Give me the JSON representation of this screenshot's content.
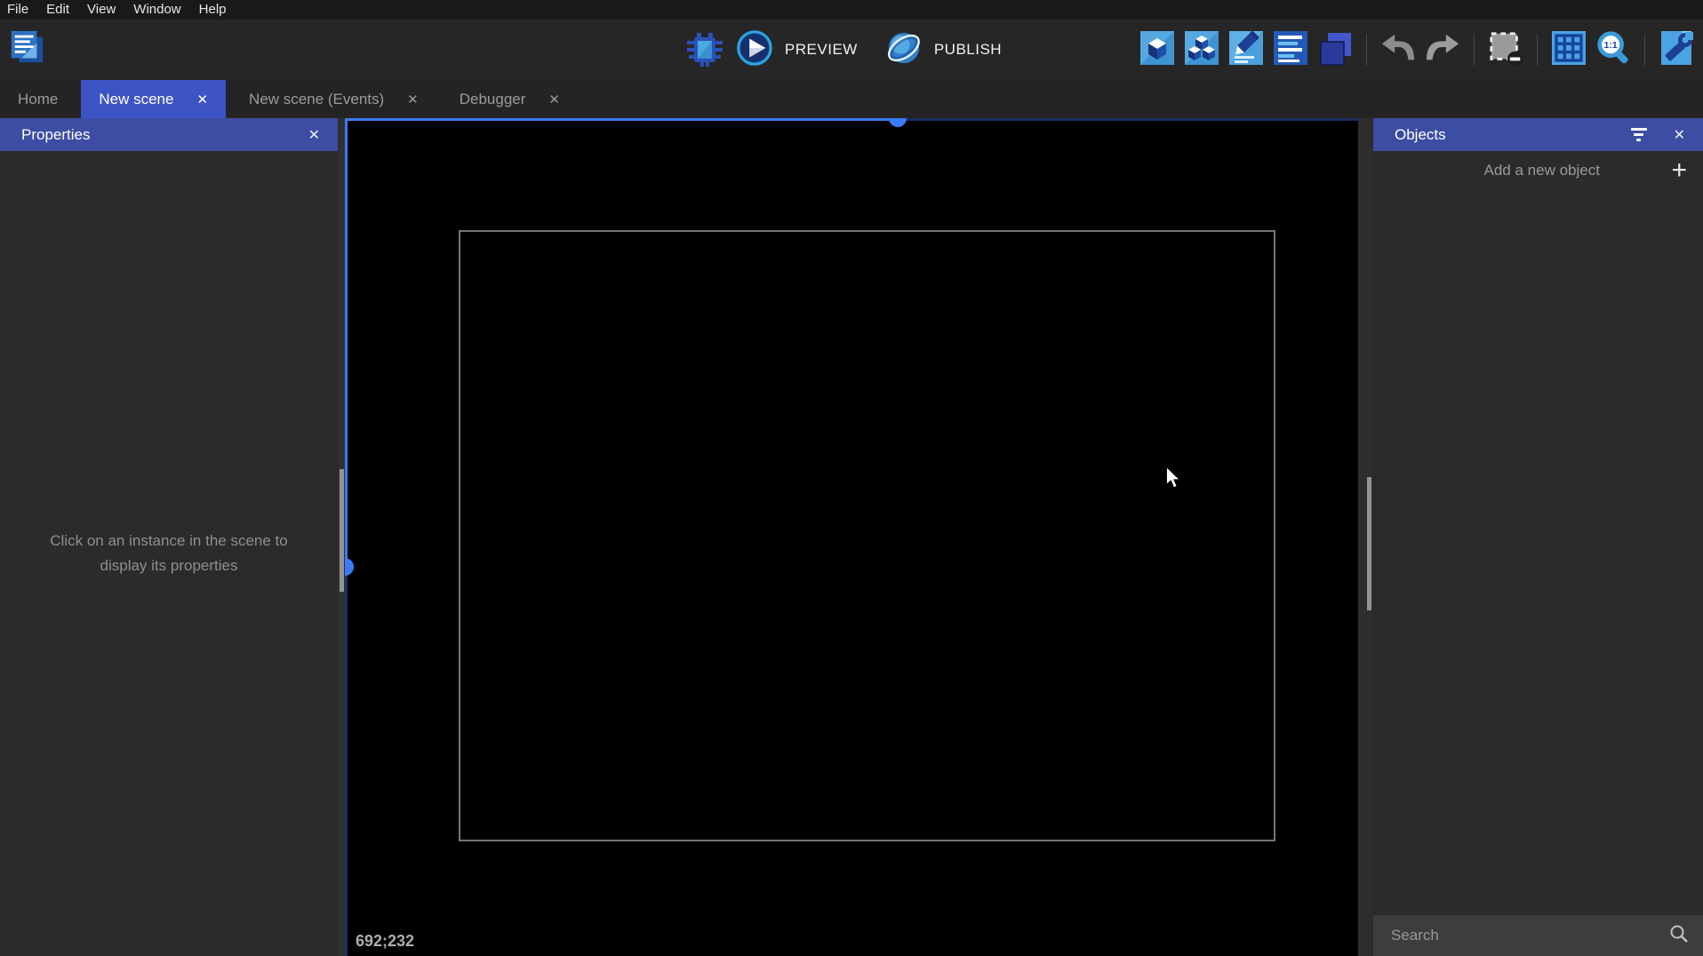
{
  "menu": {
    "items": [
      "File",
      "Edit",
      "View",
      "Window",
      "Help"
    ]
  },
  "toolbar": {
    "preview_label": "PREVIEW",
    "publish_label": "PUBLISH",
    "zoom_icon_label": "1:1"
  },
  "tabs": [
    {
      "label": "Home",
      "active": false,
      "closable": false
    },
    {
      "label": "New scene",
      "active": true,
      "closable": true
    },
    {
      "label": "New scene (Events)",
      "active": false,
      "closable": true
    },
    {
      "label": "Debugger",
      "active": false,
      "closable": true
    }
  ],
  "glyphs": {
    "close": "✕",
    "plus": "+"
  },
  "properties_panel": {
    "title": "Properties",
    "empty_message": "Click on an instance in the scene to display its properties"
  },
  "objects_panel": {
    "title": "Objects",
    "add_button_label": "Add a new object",
    "search_placeholder": "Search"
  },
  "canvas": {
    "cursor_coordinates": "692;232"
  },
  "colors": {
    "tab_active_blue": "#3d55c4",
    "panel_header_blue": "#3c4da3",
    "selection_blue": "#3a7af5",
    "selection_dark_blue": "#1b2c62",
    "icon_light_blue": "#4aa8e0",
    "icon_navy": "#1d3f94"
  }
}
